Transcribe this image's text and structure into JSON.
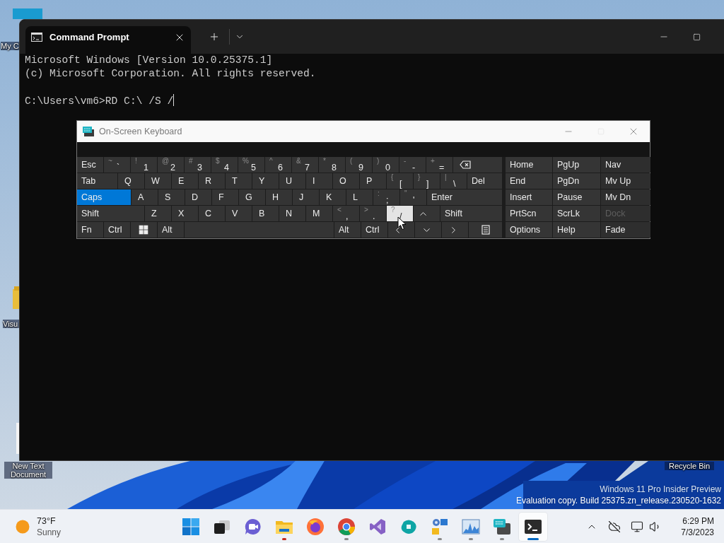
{
  "desktop": {
    "icons": [
      {
        "kind": "drive",
        "label": "My C"
      },
      {
        "kind": "folder",
        "label": "Visu"
      },
      {
        "kind": "textfile",
        "label": "New Text Document"
      },
      {
        "kind": "recycle",
        "label": "Recycle Bin"
      }
    ],
    "watermark": [
      "Windows 11 Pro Insider Preview",
      "Evaluation copy. Build 25375.zn_release.230520-1632"
    ]
  },
  "terminal": {
    "tabs": [
      {
        "title": "Command Prompt",
        "selected": true
      }
    ],
    "output": [
      "Microsoft Windows [Version 10.0.25375.1]",
      "(c) Microsoft Corporation. All rights reserved."
    ],
    "prompt": "C:\\Users\\vm6>RD C:\\ /S /"
  },
  "osk": {
    "title": "On-Screen Keyboard",
    "rows": [
      {
        "keys": [
          {
            "kind": "text",
            "label": "Esc",
            "on": false,
            "hover": false
          },
          {
            "kind": "char",
            "shift": "~",
            "main": "`",
            "on": false,
            "hover": false
          },
          {
            "kind": "char",
            "shift": "!",
            "main": "1",
            "on": false,
            "hover": false
          },
          {
            "kind": "char",
            "shift": "@",
            "main": "2",
            "on": false,
            "hover": false
          },
          {
            "kind": "char",
            "shift": "#",
            "main": "3",
            "on": false,
            "hover": false
          },
          {
            "kind": "char",
            "shift": "$",
            "main": "4",
            "on": false,
            "hover": false
          },
          {
            "kind": "char",
            "shift": "%",
            "main": "5",
            "on": false,
            "hover": false
          },
          {
            "kind": "char",
            "shift": "^",
            "main": "6",
            "on": false,
            "hover": false
          },
          {
            "kind": "char",
            "shift": "&",
            "main": "7",
            "on": false,
            "hover": false
          },
          {
            "kind": "char",
            "shift": "*",
            "main": "8",
            "on": false,
            "hover": false
          },
          {
            "kind": "char",
            "shift": "(",
            "main": "9",
            "on": false,
            "hover": false
          },
          {
            "kind": "char",
            "shift": ")",
            "main": "0",
            "on": false,
            "hover": false
          },
          {
            "kind": "char",
            "shift": "-",
            "main": "-",
            "on": false,
            "hover": false
          },
          {
            "kind": "char",
            "shift": "+",
            "main": "=",
            "on": false,
            "hover": false
          },
          {
            "kind": "backspace",
            "on": false,
            "hover": false
          }
        ]
      },
      {
        "keys": [
          {
            "kind": "text",
            "label": "Tab",
            "on": false,
            "hover": false
          },
          {
            "kind": "char",
            "main": "Q",
            "on": false,
            "hover": false
          },
          {
            "kind": "char",
            "main": "W",
            "on": false,
            "hover": false
          },
          {
            "kind": "char",
            "main": "E",
            "on": false,
            "hover": false
          },
          {
            "kind": "char",
            "main": "R",
            "on": false,
            "hover": false
          },
          {
            "kind": "char",
            "main": "T",
            "on": false,
            "hover": false
          },
          {
            "kind": "char",
            "main": "Y",
            "on": false,
            "hover": false
          },
          {
            "kind": "char",
            "main": "U",
            "on": false,
            "hover": false
          },
          {
            "kind": "char",
            "main": "I",
            "on": false,
            "hover": false
          },
          {
            "kind": "char",
            "main": "O",
            "on": false,
            "hover": false
          },
          {
            "kind": "char",
            "main": "P",
            "on": false,
            "hover": false
          },
          {
            "kind": "char",
            "shift": "{",
            "main": "[",
            "on": false,
            "hover": false
          },
          {
            "kind": "char",
            "shift": "}",
            "main": "]",
            "on": false,
            "hover": false
          },
          {
            "kind": "char",
            "shift": "|",
            "main": "\\",
            "on": false,
            "hover": false
          },
          {
            "kind": "text",
            "label": "Del",
            "on": false,
            "hover": false
          }
        ]
      },
      {
        "keys": [
          {
            "kind": "text",
            "label": "Caps",
            "on": true,
            "hover": false
          },
          {
            "kind": "char",
            "main": "A",
            "on": false,
            "hover": false
          },
          {
            "kind": "char",
            "main": "S",
            "on": false,
            "hover": false
          },
          {
            "kind": "char",
            "main": "D",
            "on": false,
            "hover": false
          },
          {
            "kind": "char",
            "main": "F",
            "on": false,
            "hover": false
          },
          {
            "kind": "char",
            "main": "G",
            "on": false,
            "hover": false
          },
          {
            "kind": "char",
            "main": "H",
            "on": false,
            "hover": false
          },
          {
            "kind": "char",
            "main": "J",
            "on": false,
            "hover": false
          },
          {
            "kind": "char",
            "main": "K",
            "on": false,
            "hover": false
          },
          {
            "kind": "char",
            "main": "L",
            "on": false,
            "hover": false
          },
          {
            "kind": "char",
            "shift": ":",
            "main": ";",
            "on": false,
            "hover": false
          },
          {
            "kind": "char",
            "shift": "\"",
            "main": "'",
            "on": false,
            "hover": false
          },
          {
            "kind": "text",
            "label": "Enter",
            "on": false,
            "hover": false
          }
        ]
      },
      {
        "keys": [
          {
            "kind": "text",
            "label": "Shift",
            "on": false,
            "hover": false
          },
          {
            "kind": "char",
            "main": "Z",
            "on": false,
            "hover": false
          },
          {
            "kind": "char",
            "main": "X",
            "on": false,
            "hover": false
          },
          {
            "kind": "char",
            "main": "C",
            "on": false,
            "hover": false
          },
          {
            "kind": "char",
            "main": "V",
            "on": false,
            "hover": false
          },
          {
            "kind": "char",
            "main": "B",
            "on": false,
            "hover": false
          },
          {
            "kind": "char",
            "main": "N",
            "on": false,
            "hover": false
          },
          {
            "kind": "char",
            "main": "M",
            "on": false,
            "hover": false
          },
          {
            "kind": "char",
            "shift": "<",
            "main": ",",
            "on": false,
            "hover": false
          },
          {
            "kind": "char",
            "shift": ">",
            "main": ".",
            "on": false,
            "hover": false
          },
          {
            "kind": "char",
            "shift": "?",
            "main": "/",
            "on": false,
            "hover": true
          },
          {
            "kind": "up",
            "on": false,
            "hover": false
          },
          {
            "kind": "text",
            "label": "Shift",
            "on": false,
            "hover": false
          }
        ]
      },
      {
        "keys": [
          {
            "kind": "text",
            "label": "Fn",
            "on": false,
            "hover": false
          },
          {
            "kind": "text",
            "label": "Ctrl",
            "on": false,
            "hover": false
          },
          {
            "kind": "windows",
            "on": false,
            "hover": false
          },
          {
            "kind": "text",
            "label": "Alt",
            "on": false,
            "hover": false
          },
          {
            "kind": "space",
            "on": false,
            "hover": false
          },
          {
            "kind": "text",
            "label": "Alt",
            "on": false,
            "hover": false
          },
          {
            "kind": "text",
            "label": "Ctrl",
            "on": false,
            "hover": false
          },
          {
            "kind": "left",
            "on": false,
            "hover": false
          },
          {
            "kind": "down",
            "on": false,
            "hover": false
          },
          {
            "kind": "right",
            "on": false,
            "hover": false
          },
          {
            "kind": "menu",
            "on": false,
            "hover": false
          }
        ]
      }
    ],
    "nav": [
      [
        {
          "label": "Home",
          "disabled": false
        },
        {
          "label": "PgUp",
          "disabled": false
        },
        {
          "label": "Nav",
          "disabled": false
        }
      ],
      [
        {
          "label": "End",
          "disabled": false
        },
        {
          "label": "PgDn",
          "disabled": false
        },
        {
          "label": "Mv Up",
          "disabled": false
        }
      ],
      [
        {
          "label": "Insert",
          "disabled": false
        },
        {
          "label": "Pause",
          "disabled": false
        },
        {
          "label": "Mv Dn",
          "disabled": false
        }
      ],
      [
        {
          "label": "PrtScn",
          "disabled": false
        },
        {
          "label": "ScrLk",
          "disabled": false
        },
        {
          "label": "Dock",
          "disabled": true
        }
      ],
      [
        {
          "label": "Options",
          "disabled": false
        },
        {
          "label": "Help",
          "disabled": false
        },
        {
          "label": "Fade",
          "disabled": false
        }
      ]
    ]
  },
  "taskbar": {
    "weather": {
      "temperature": "73°F",
      "condition": "Sunny"
    },
    "apps": [
      {
        "kind": "start",
        "running": false,
        "active": false
      },
      {
        "kind": "taskview",
        "running": false,
        "active": false
      },
      {
        "kind": "chat",
        "running": false,
        "active": false
      },
      {
        "kind": "explorer",
        "running": true,
        "active": false,
        "color": "#c42b1c"
      },
      {
        "kind": "firefox",
        "running": false,
        "active": false
      },
      {
        "kind": "chrome",
        "running": true,
        "active": false,
        "color": "#8a8a8a"
      },
      {
        "kind": "vs",
        "running": false,
        "active": false
      },
      {
        "kind": "teal",
        "running": false,
        "active": false
      },
      {
        "kind": "control",
        "running": true,
        "active": false,
        "color": "#8a8a8a"
      },
      {
        "kind": "monitor",
        "running": true,
        "active": false,
        "color": "#8a8a8a"
      },
      {
        "kind": "keyboard",
        "running": true,
        "active": false,
        "color": "#8a8a8a"
      },
      {
        "kind": "terminal",
        "running": true,
        "active": true,
        "color": "#0067c0"
      }
    ],
    "clock": {
      "time": "6:29 PM",
      "date": "7/3/2023"
    }
  }
}
